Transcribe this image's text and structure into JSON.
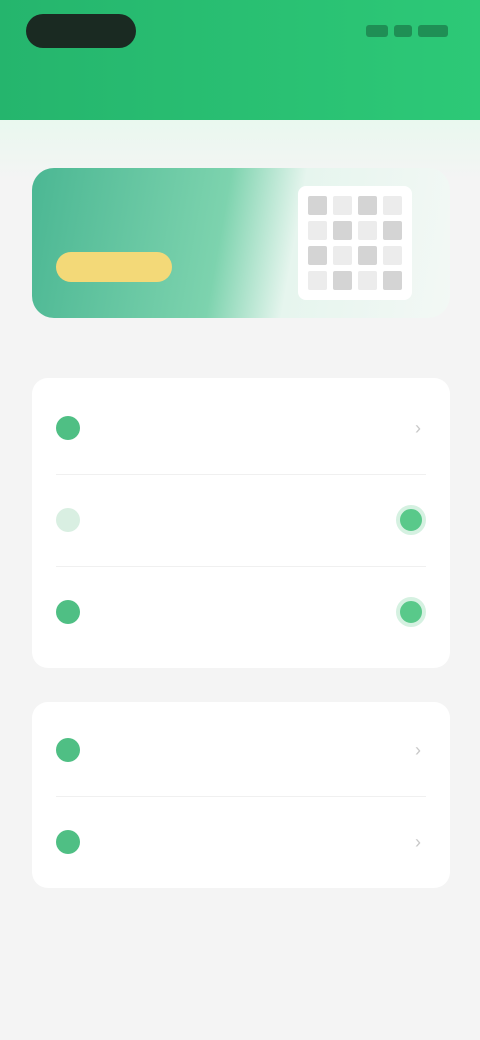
{
  "header": {
    "title": ""
  },
  "banner": {
    "button_label": "",
    "caption": ""
  },
  "settings_group": {
    "items": [
      {
        "label": "",
        "value": "",
        "icon": "setting-dot-icon"
      },
      {
        "label": "",
        "icon": "setting-dot-icon",
        "control": "toggle"
      },
      {
        "label": "",
        "icon": "setting-dot-icon",
        "control": "toggle"
      }
    ],
    "note": ""
  },
  "section2": {
    "label": "",
    "items": [
      {
        "label": "",
        "icon": "setting-dot-icon"
      },
      {
        "label": "",
        "icon": "setting-dot-icon"
      }
    ]
  },
  "footer": {
    "link_label": ""
  },
  "colors": {
    "brand_green": "#2dc977",
    "accent_yellow": "#f3d978"
  }
}
